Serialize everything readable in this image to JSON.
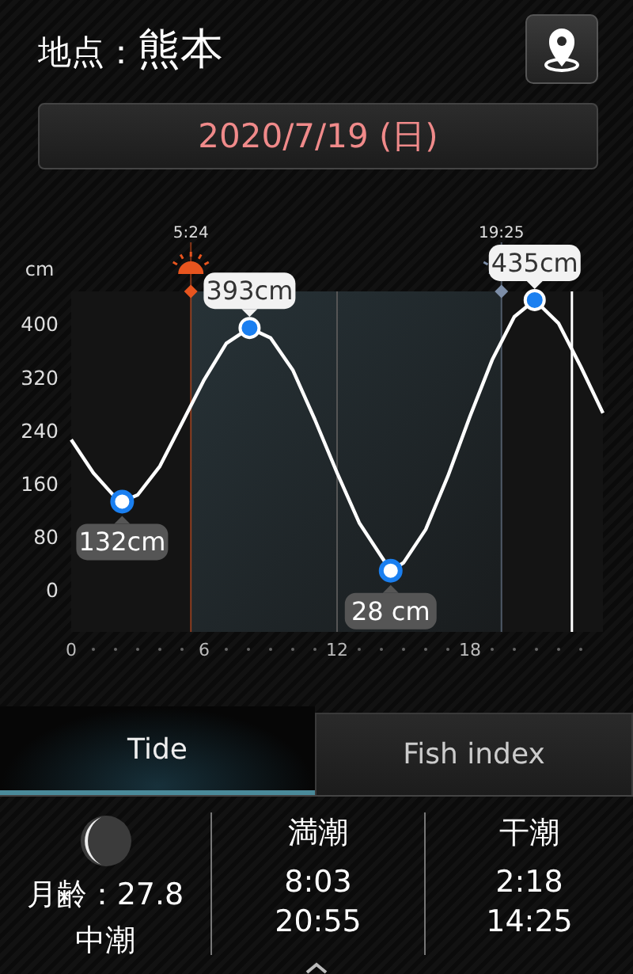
{
  "header": {
    "label": "地点：",
    "location": "熊本"
  },
  "date": {
    "text": "2020/7/19 (日)"
  },
  "chart": {
    "chart_data": {
      "type": "line",
      "ylabel": "cm",
      "xlim": [
        0,
        24
      ],
      "ylim": [
        -64,
        448
      ],
      "xticks": [
        0,
        6,
        12,
        18
      ],
      "yticks": [
        0,
        80,
        160,
        240,
        320,
        400
      ],
      "x": [
        0,
        1,
        2,
        2.3,
        3,
        4,
        5,
        6,
        7,
        8.05,
        9,
        10,
        11,
        12,
        13,
        14.42,
        15,
        16,
        17,
        18,
        19,
        20,
        20.92,
        22,
        23,
        24
      ],
      "series": [
        {
          "color": "#ffffff",
          "values": [
            225,
            175,
            138,
            132,
            142,
            185,
            250,
            315,
            370,
            393,
            378,
            330,
            255,
            175,
            100,
            28,
            40,
            90,
            170,
            260,
            345,
            410,
            435,
            400,
            335,
            265
          ]
        }
      ],
      "ref_lines": [
        {
          "axis": "x",
          "value": 5.4,
          "label": "5:24",
          "color": "#e8551f"
        },
        {
          "axis": "x",
          "value": 19.42,
          "label": "19:25",
          "color": "#7d8ea8"
        },
        {
          "axis": "x",
          "value": 22.6,
          "color": "#ffffff"
        }
      ],
      "bands": [
        {
          "axis": "x",
          "from": 5.4,
          "to": 19.42
        }
      ],
      "annotations": [
        {
          "x": 2.3,
          "y": 132,
          "text": "132cm"
        },
        {
          "x": 8.05,
          "y": 393,
          "text": "393cm"
        },
        {
          "x": 14.42,
          "y": 28,
          "text": "28 cm"
        },
        {
          "x": 20.92,
          "y": 435,
          "text": "435cm"
        }
      ]
    }
  },
  "tabs": [
    {
      "label": "Tide",
      "selected": true
    },
    {
      "label": "Fish index",
      "selected": false
    }
  ],
  "moon": {
    "age": "月齢：27.8",
    "tide_name": "中潮"
  },
  "tide_columns": [
    {
      "title": "満潮",
      "times": [
        "8:03",
        "20:55"
      ]
    },
    {
      "title": "干潮",
      "times": [
        "2:18",
        "14:25"
      ]
    }
  ]
}
